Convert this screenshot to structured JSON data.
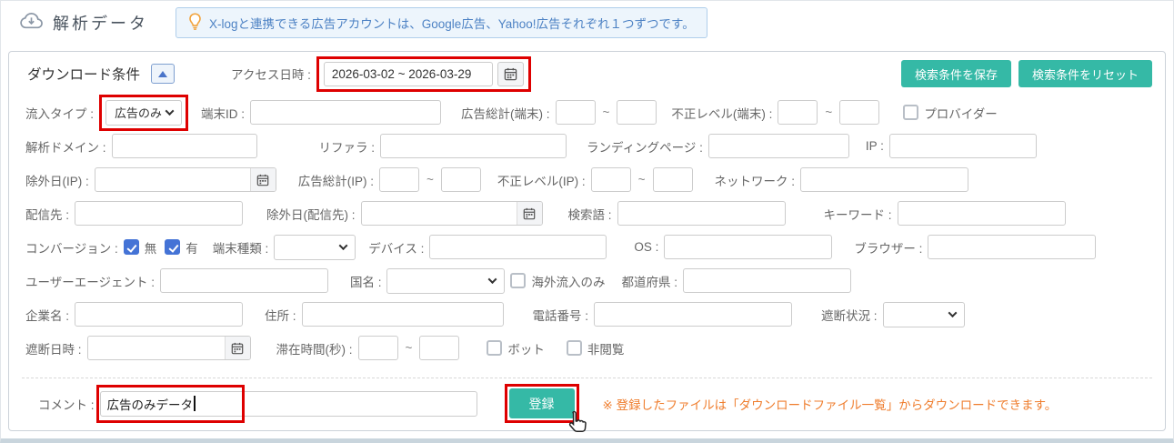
{
  "header": {
    "title": "解析データ",
    "notice": "X-logと連携できる広告アカウントは、Google広告、Yahoo!広告それぞれ１つずつです。"
  },
  "panel": {
    "title": "ダウンロード条件",
    "access_date_label": "アクセス日時 :",
    "access_date_value": "2026-03-02 ~ 2026-03-29",
    "save_button": "検索条件を保存",
    "reset_button": "検索条件をリセット"
  },
  "fields": {
    "inflow_type": {
      "label": "流入タイプ :",
      "value": "広告のみ"
    },
    "terminal_id": {
      "label": "端末ID :",
      "value": ""
    },
    "ad_total_terminal": {
      "label": "広告総計(端末) :",
      "min": "",
      "max": ""
    },
    "fraud_level_terminal": {
      "label": "不正レベル(端末) :",
      "min": "",
      "max": ""
    },
    "provider": {
      "label": "プロバイダー",
      "checked": false
    },
    "analysis_domain": {
      "label": "解析ドメイン :",
      "value": ""
    },
    "referrer": {
      "label": "リファラ :",
      "value": ""
    },
    "landing_page": {
      "label": "ランディングページ :",
      "value": ""
    },
    "ip": {
      "label": "IP :",
      "value": ""
    },
    "exclude_date_ip": {
      "label": "除外日(IP) :",
      "value": ""
    },
    "ad_total_ip": {
      "label": "広告総計(IP) :",
      "min": "",
      "max": ""
    },
    "fraud_level_ip": {
      "label": "不正レベル(IP) :",
      "min": "",
      "max": ""
    },
    "network": {
      "label": "ネットワーク :",
      "value": ""
    },
    "delivery_dest": {
      "label": "配信先 :",
      "value": ""
    },
    "exclude_date_delivery": {
      "label": "除外日(配信先) :",
      "value": ""
    },
    "search_term": {
      "label": "検索語 :",
      "value": ""
    },
    "keyword": {
      "label": "キーワード :",
      "value": ""
    },
    "conversion": {
      "label": "コンバージョン :",
      "option_none": "無",
      "option_yes": "有",
      "none_checked": true,
      "yes_checked": true
    },
    "terminal_type": {
      "label": "端末種類 :",
      "value": ""
    },
    "device": {
      "label": "デバイス :",
      "value": ""
    },
    "os": {
      "label": "OS :",
      "value": ""
    },
    "browser": {
      "label": "ブラウザー :",
      "value": ""
    },
    "user_agent": {
      "label": "ユーザーエージェント :",
      "value": ""
    },
    "country": {
      "label": "国名 :",
      "value": ""
    },
    "overseas_only": {
      "label": "海外流入のみ",
      "checked": false
    },
    "prefecture": {
      "label": "都道府県 :",
      "value": ""
    },
    "company": {
      "label": "企業名 :",
      "value": ""
    },
    "address": {
      "label": "住所 :",
      "value": ""
    },
    "phone": {
      "label": "電話番号 :",
      "value": ""
    },
    "block_status": {
      "label": "遮断状況 :",
      "value": ""
    },
    "block_datetime": {
      "label": "遮断日時 :",
      "value": ""
    },
    "stay_time": {
      "label": "滞在時間(秒) :",
      "min": "",
      "max": ""
    },
    "bot": {
      "label": "ボット",
      "checked": false
    },
    "non_view": {
      "label": "非閲覧",
      "checked": false
    }
  },
  "footer": {
    "comment_label": "コメント :",
    "comment_value": "広告のみデータ",
    "register_button": "登録",
    "note": "※ 登録したファイルは「ダウンロードファイル一覧」からダウンロードできます。"
  },
  "misc": {
    "tilde": "~"
  },
  "colors": {
    "accent_teal": "#35b9a6",
    "annotation_red": "#de0000",
    "notice_blue": "#4d82c4",
    "checkbox_blue": "#4473d6",
    "note_orange": "#ef7d2d"
  }
}
